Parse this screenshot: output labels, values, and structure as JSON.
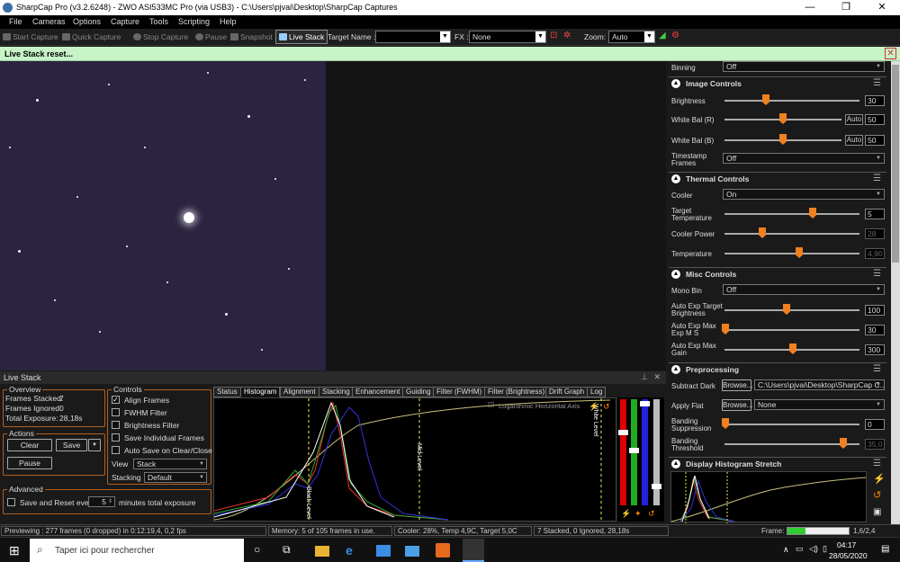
{
  "window": {
    "title": "SharpCap Pro (v3.2.6248) - ZWO ASI533MC Pro (via USB3) - C:\\Users\\pjvai\\Desktop\\SharpCap Captures",
    "minimize": "—",
    "maximize": "❐",
    "close": "✕"
  },
  "menu": [
    "File",
    "Cameras",
    "Options",
    "Capture",
    "Tools",
    "Scripting",
    "Help"
  ],
  "toolbar": {
    "start_capture": "Start Capture",
    "quick_capture": "Quick Capture",
    "stop_capture": "Stop Capture",
    "pause": "Pause",
    "snapshot": "Snapshot",
    "live_stack": "Live Stack",
    "target_label": "Target Name :",
    "target_value": "",
    "fx_label": "FX :",
    "fx_value": "None",
    "zoom_label": "Zoom:",
    "zoom_value": "Auto"
  },
  "notification": "Live Stack reset...",
  "live_stack": {
    "title": "Live Stack",
    "overview_label": "Overview",
    "frames_stacked_label": "Frames Stacked:",
    "frames_stacked": "7",
    "frames_ignored_label": "Frames Ignored:",
    "frames_ignored": "0",
    "total_exposure_label": "Total Exposure:",
    "total_exposure": "28,18s",
    "actions_label": "Actions",
    "clear": "Clear",
    "save": "Save",
    "pause": "Pause",
    "controls_label": "Controls",
    "align_frames": "Align Frames",
    "fwhm_filter": "FWHM Filter",
    "brightness_filter": "Brightness Filter",
    "save_individual": "Save Individual Frames",
    "auto_save": "Auto Save on Clear/Close",
    "view_label": "View",
    "view_value": "Stack",
    "stacking_label": "Stacking",
    "stacking_value": "Default",
    "advanced_label": "Advanced",
    "save_reset_label": "Save and Reset every",
    "save_reset_value": "5",
    "minutes_label": "minutes total exposure",
    "tabs": [
      "Status",
      "Histogram",
      "Alignment",
      "Stacking",
      "Enhancement",
      "Guiding",
      "Filter (FWHM)",
      "Filter (Brightness)",
      "Drift Graph",
      "Log"
    ],
    "log_axis": "Logarithmic Horizontal Axis",
    "black_level": "Black Level",
    "mid_level": "Mid Level",
    "white_level": "White Level"
  },
  "right_panel": {
    "binning_label": "Binning",
    "binning_value": "Off",
    "image_controls": "Image Controls",
    "brightness_label": "Brightness",
    "brightness_value": "30",
    "wb_r_label": "White Bal (R)",
    "wb_r_value": "50",
    "wb_b_label": "White Bal (B)",
    "wb_b_value": "50",
    "auto": "Auto",
    "timestamp_label": "Timestamp Frames",
    "timestamp_value": "Off",
    "thermal_controls": "Thermal Controls",
    "cooler_label": "Cooler",
    "cooler_value": "On",
    "target_temp_label": "Target Temperature",
    "target_temp_value": "5",
    "cooler_power_label": "Cooler Power",
    "cooler_power_value": "28",
    "temperature_label": "Temperature",
    "temperature_value": "4,90",
    "misc_controls": "Misc Controls",
    "mono_bin_label": "Mono Bin",
    "mono_bin_value": "Off",
    "aet_brightness_label": "Auto Exp Target Brightness",
    "aet_brightness_value": "100",
    "aem_exp_label": "Auto Exp Max Exp M S",
    "aem_exp_value": "30",
    "aem_gain_label": "Auto Exp Max Gain",
    "aem_gain_value": "300",
    "preprocessing": "Preprocessing",
    "subtract_dark_label": "Subtract Dark",
    "browse": "Browse...",
    "subtract_dark_value": "C:\\Users\\pjvai\\Desktop\\SharpCap C...",
    "apply_flat_label": "Apply Flat",
    "apply_flat_value": "None",
    "banding_supp_label": "Banding Suppression",
    "banding_supp_value": "0",
    "banding_thresh_label": "Banding Threshold",
    "banding_thresh_value": "35,0",
    "display_histogram": "Display Histogram Stretch"
  },
  "status": {
    "previewing": "Previewing : 277 frames (0 dropped) in 0:12:19,4, 0,2 fps",
    "memory": "Memory: 5 of 105 frames in use.",
    "cooler": "Cooler: 28%, Temp 4,9C, Target 5,0C",
    "stacked": "7 Stacked, 0 Ignored, 28,18s",
    "frame_label": "Frame:",
    "frame_value": "1,6/2,4",
    "frame_progress": 0.3
  },
  "taskbar": {
    "search_placeholder": "Taper ici pour rechercher",
    "time": "04:17",
    "date": "28/05/2020"
  },
  "colors": {
    "accent": "#f08020",
    "notify_bg": "#c7f3c7",
    "image_bg": "#2b2340"
  }
}
